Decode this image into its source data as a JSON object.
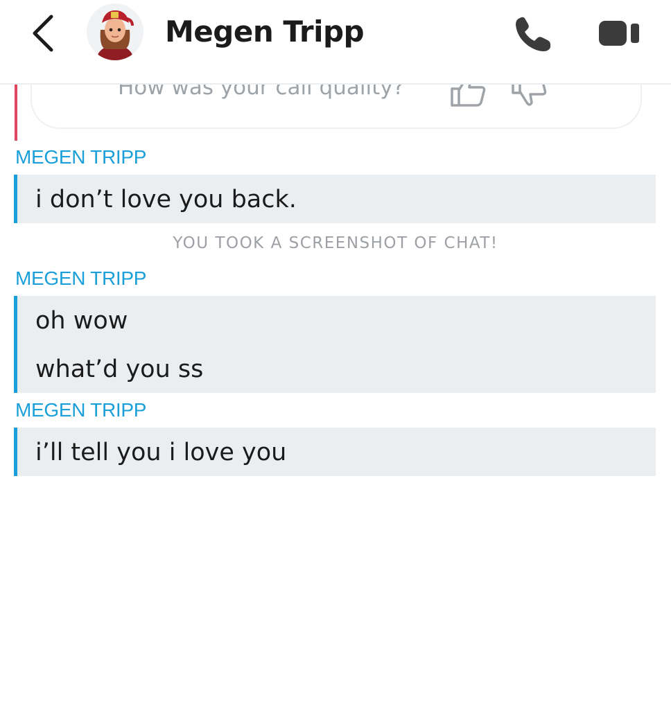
{
  "header": {
    "contact_name": "Megen Tripp",
    "back_icon": "chevron-left-icon",
    "call_icon": "phone-icon",
    "video_icon": "video-camera-icon",
    "avatar_icon": "bitmoji-avatar"
  },
  "call_feedback": {
    "question": "How was your call quality?",
    "thumb_up_icon": "thumbs-up-icon",
    "thumb_down_icon": "thumbs-down-icon",
    "accent_color": "#e0475f"
  },
  "messages": [
    {
      "sender": "MEGEN TRIPP",
      "lines": [
        "i don’t love you back."
      ]
    },
    {
      "sender": "MEGEN TRIPP",
      "lines": [
        "oh wow",
        "what’d you ss"
      ]
    },
    {
      "sender": "MEGEN TRIPP",
      "lines": [
        "i’ll tell you i love you"
      ]
    }
  ],
  "system_notice": "YOU TOOK A SCREENSHOT OF CHAT!",
  "colors": {
    "sender_accent": "#1a9fd9",
    "bubble_bg": "#ebeef1",
    "notice_text": "#9da1a6"
  }
}
